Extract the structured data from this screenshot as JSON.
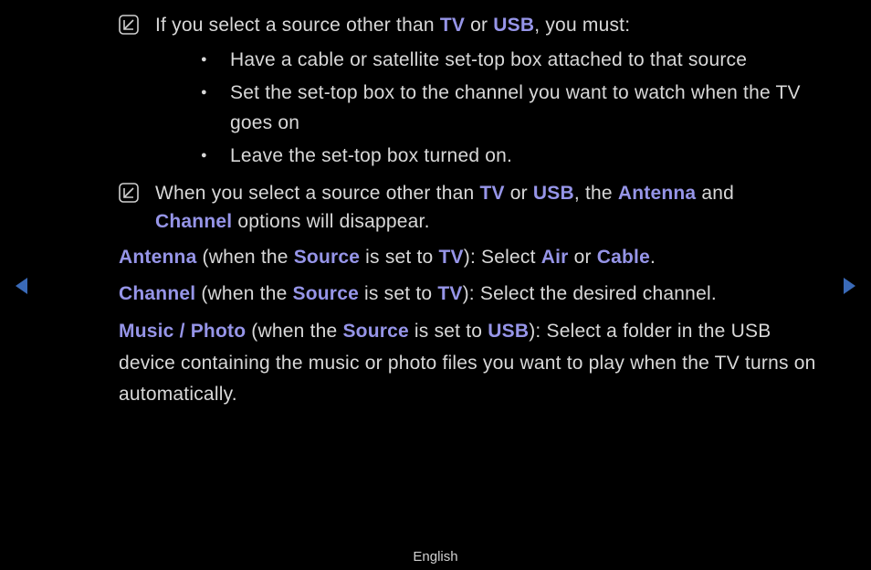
{
  "note1": {
    "pre": "If you select a source other than ",
    "tv": "TV",
    "mid1": " or ",
    "usb": "USB",
    "post": ", you must:"
  },
  "bullets": {
    "b1": "Have a cable or satellite set-top box attached to that source",
    "b2": "Set the set-top box to the channel you want to watch when the TV goes on",
    "b3": "Leave the set-top box turned on."
  },
  "note2": {
    "pre": "When you select a source other than ",
    "tv": "TV",
    "mid1": " or ",
    "usb": "USB",
    "mid2": ", the ",
    "antenna": "Antenna",
    "mid3": " and ",
    "channel": "Channel",
    "post": " options will disappear."
  },
  "antenna_line": {
    "label": "Antenna",
    "p1": " (when the ",
    "source": "Source",
    "p2": " is set to ",
    "tv": "TV",
    "p3": "): Select ",
    "air": "Air",
    "p4": " or ",
    "cable": "Cable",
    "p5": "."
  },
  "channel_line": {
    "label": "Channel",
    "p1": " (when the ",
    "source": "Source",
    "p2": " is set to ",
    "tv": "TV",
    "p3": "): Select the desired channel."
  },
  "music_line": {
    "label": "Music / Photo",
    "p1": " (when the ",
    "source": "Source",
    "p2": " is set to ",
    "usb": "USB",
    "p3": "): Select a folder in the USB device containing the music or photo files you want to play when the TV turns on automatically."
  },
  "footer": "English"
}
